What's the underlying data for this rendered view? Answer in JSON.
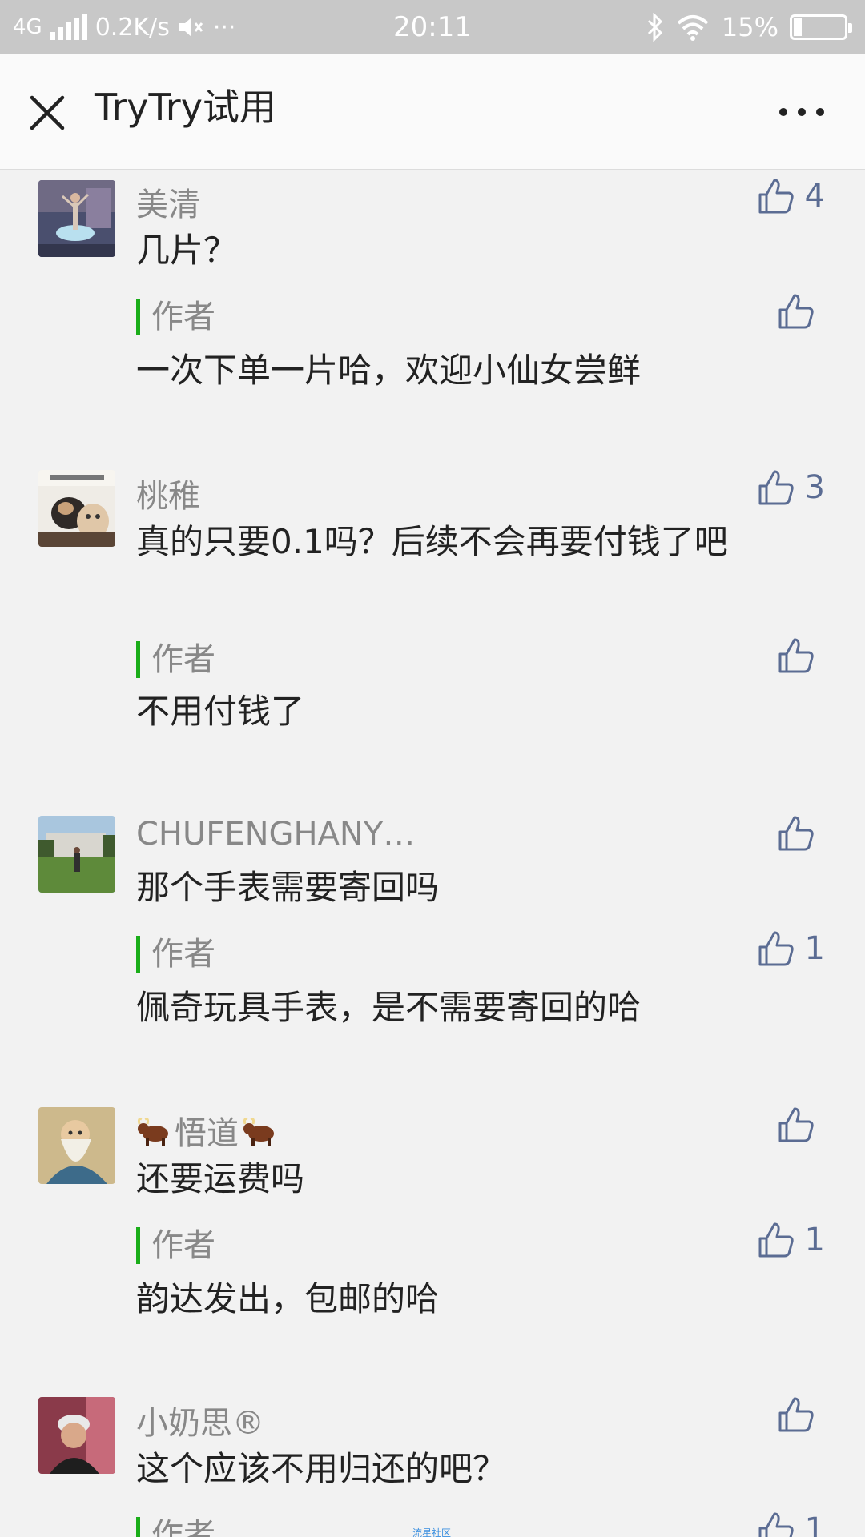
{
  "status_bar": {
    "network": "4G",
    "speed": "0.2K/s",
    "more_dots": "···",
    "time": "20:11",
    "battery_text": "15%",
    "battery_level": 0.15
  },
  "nav": {
    "title": "TryTry试用"
  },
  "comments": [
    {
      "name": "美清",
      "text": "几片？",
      "likes": "4",
      "reply": {
        "tag": "作者",
        "text": "一次下单一片哈，欢迎小仙女尝鲜",
        "likes": ""
      }
    },
    {
      "name": "桃稚",
      "text": "真的只要0.1吗？后续不会再要付钱了吧",
      "likes": "3",
      "reply": {
        "tag": "作者",
        "text": "不用付钱了",
        "likes": ""
      }
    },
    {
      "name": "CHUFENGHANY…",
      "text": "那个手表需要寄回吗",
      "likes": "",
      "reply": {
        "tag": "作者",
        "text": "佩奇玩具手表，是不需要寄回的哈",
        "likes": "1"
      }
    },
    {
      "name": "悟道",
      "text": "还要运费吗",
      "likes": "",
      "reply": {
        "tag": "作者",
        "text": "韵达发出，包邮的哈",
        "likes": "1"
      }
    },
    {
      "name": "小奶思®",
      "text": "这个应该不用归还的吧？",
      "likes": "",
      "reply": {
        "tag": "作者",
        "text": "",
        "likes": "1"
      }
    }
  ],
  "watermark": "流星社区",
  "colors": {
    "accent_green": "#1aad19",
    "like_blue": "#5b6c93"
  },
  "icons": {
    "close": "close-icon",
    "more": "more-icon",
    "like": "thumbs-up-icon"
  }
}
